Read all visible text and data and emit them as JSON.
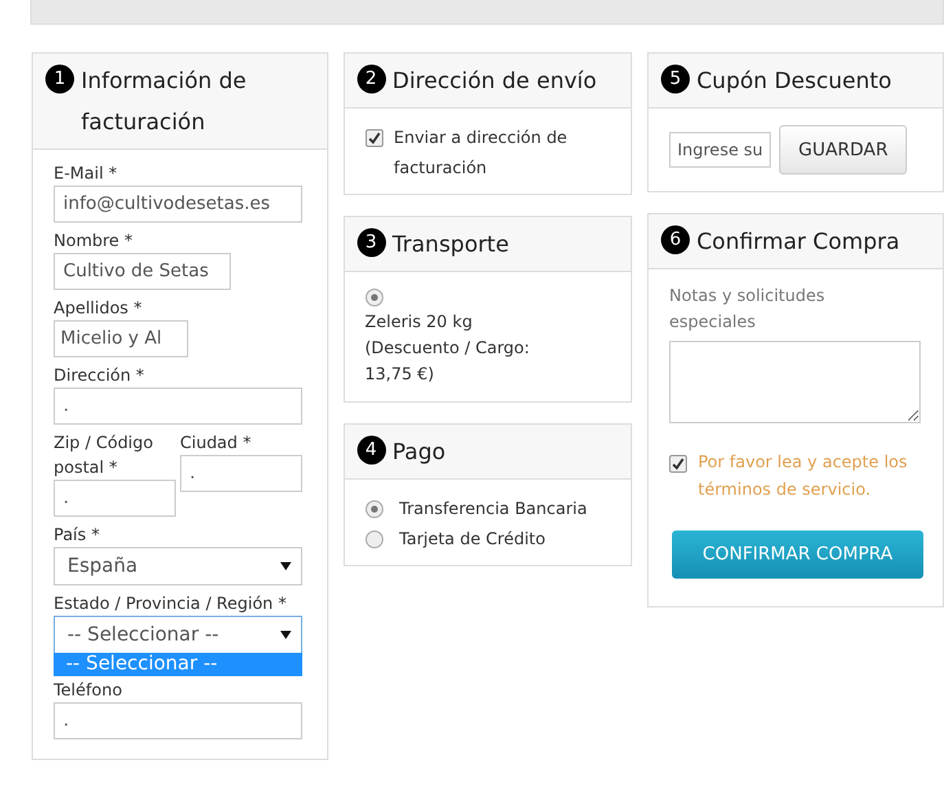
{
  "billing": {
    "number": "1",
    "title": "Información de facturación",
    "fields": [
      {
        "kind": "input",
        "label": "E-Mail *",
        "value": "info@cultivodesetas.es"
      },
      {
        "kind": "input",
        "label": "Nombre *",
        "value": "Cultivo de Setas"
      },
      {
        "kind": "input",
        "label": "Apellidos *",
        "value": "Micelio y Al"
      },
      {
        "kind": "input",
        "label": "Dirección *",
        "value": "."
      },
      {
        "kind": "pair",
        "items": [
          {
            "label": "Zip / Código postal *",
            "value": "."
          },
          {
            "label": "Ciudad *",
            "value": "."
          }
        ]
      },
      {
        "kind": "select",
        "label": "País *",
        "value": "España",
        "focused": false
      },
      {
        "kind": "select",
        "label": "Estado / Provincia / Región *",
        "value": "-- Seleccionar --",
        "focused": true,
        "open_option": "-- Seleccionar --"
      },
      {
        "kind": "input",
        "label": "Teléfono",
        "value": "."
      }
    ]
  },
  "shipping": {
    "number": "2",
    "title": "Dirección de envío",
    "checkbox": {
      "label": "Enviar a dirección de facturación",
      "checked": true
    }
  },
  "transport": {
    "number": "3",
    "title": "Transporte",
    "options": [
      {
        "label": "Zeleris 20 kg (Descuento / Cargo: 13,75 €)",
        "selected": true
      }
    ]
  },
  "payment": {
    "number": "4",
    "title": "Pago",
    "options": [
      {
        "label": "Transferencia Bancaria",
        "selected": true
      },
      {
        "label": "Tarjeta de Crédito",
        "selected": false
      }
    ]
  },
  "coupon": {
    "number": "5",
    "title": "Cupón Descuento",
    "placeholder": "Ingrese su",
    "button": "GUARDAR"
  },
  "confirm": {
    "number": "6",
    "title": "Confirmar Compra",
    "notes_label": "Notas y solicitudes especiales",
    "terms": {
      "label": "Por favor lea y acepte los términos de servicio.",
      "checked": true
    },
    "button": "CONFIRMAR COMPRA"
  }
}
